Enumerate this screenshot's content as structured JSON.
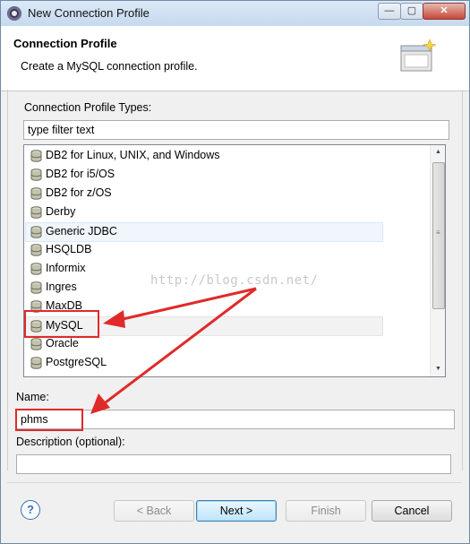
{
  "window": {
    "title": "New Connection Profile",
    "controls": {
      "minimize": "—",
      "maximize": "▢",
      "close": "✕"
    }
  },
  "header": {
    "title": "Connection Profile",
    "description": "Create a MySQL connection profile."
  },
  "types_label": "Connection Profile Types:",
  "filter": {
    "value": "type filter text"
  },
  "profile_types": [
    "DB2 for Linux, UNIX, and Windows",
    "DB2 for i5/OS",
    "DB2 for z/OS",
    "Derby",
    "Generic JDBC",
    "HSQLDB",
    "Informix",
    "Ingres",
    "MaxDB",
    "MySQL",
    "Oracle",
    "PostgreSQL"
  ],
  "selected_type": "MySQL",
  "watermark": "http://blog.csdn.net/",
  "name": {
    "label": "Name:",
    "value": "phms"
  },
  "description": {
    "label": "Description (optional):",
    "value": ""
  },
  "buttons": {
    "help": "?",
    "back": "< Back",
    "next": "Next >",
    "finish": "Finish",
    "cancel": "Cancel"
  },
  "colors": {
    "annotation": "#e02a2a",
    "accent": "#3c7fb1"
  }
}
